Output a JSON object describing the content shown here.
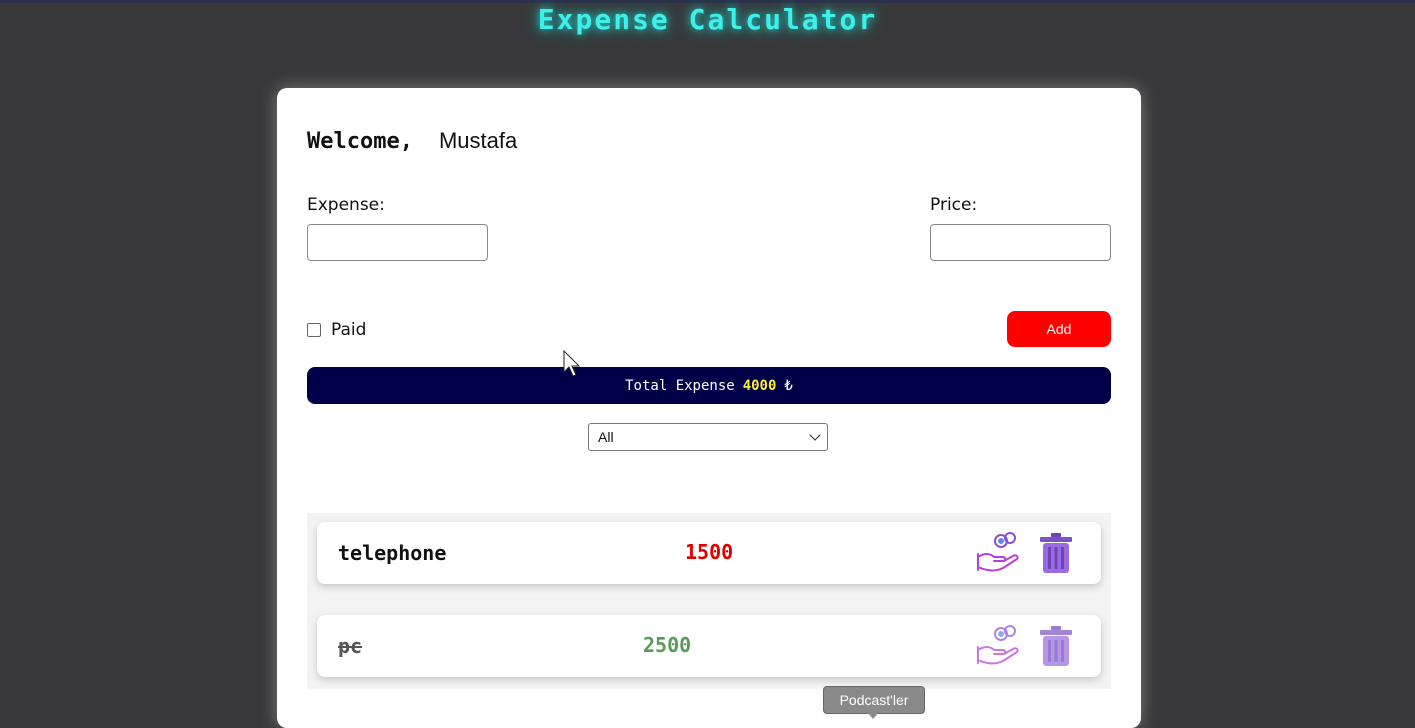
{
  "app": {
    "title": "Expense Calculator"
  },
  "welcome": {
    "greeting": "Welcome,",
    "username": "Mustafa"
  },
  "form": {
    "expense_label": "Expense:",
    "expense_value": "",
    "price_label": "Price:",
    "price_value": "",
    "paid_label": "Paid",
    "paid_checked": false,
    "add_label": "Add"
  },
  "total": {
    "label": "Total Expense",
    "value": "4000",
    "currency": "₺"
  },
  "filter": {
    "selected": "All"
  },
  "items": [
    {
      "name": "telephone",
      "price": "1500",
      "paid": false,
      "price_color": "#e00000"
    },
    {
      "name": "pc",
      "price": "2500",
      "paid": true,
      "price_color": "#2e7d32"
    }
  ],
  "tooltip": {
    "text": "Podcast'ler"
  },
  "colors": {
    "title": "#3ef0ea",
    "add_button": "#ff0000",
    "total_bar": "#000048",
    "total_value": "#ffeb3b",
    "icons": "#8a4fd6"
  },
  "icons": {
    "pay": "hand-coin-icon",
    "delete": "trash-icon"
  }
}
